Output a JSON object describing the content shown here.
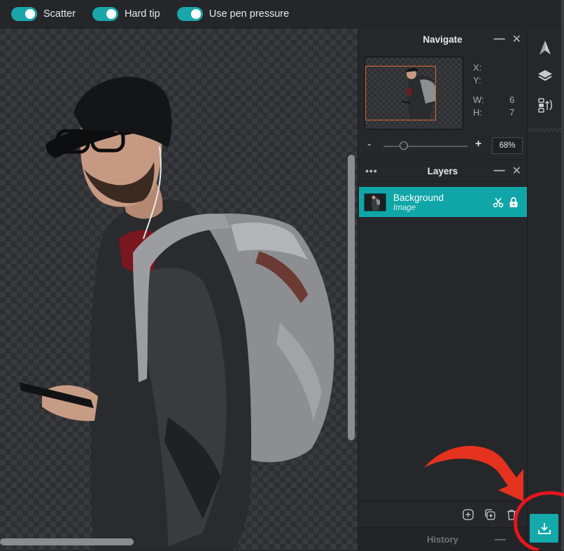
{
  "toolbar": {
    "toggles": [
      {
        "label": "Scatter",
        "on": true
      },
      {
        "label": "Hard tip",
        "on": true
      },
      {
        "label": "Use pen pressure",
        "on": true
      }
    ],
    "accent": "#1aa6a8"
  },
  "navigate": {
    "title": "Navigate",
    "minimize": "—",
    "close": "✕",
    "x_label": "X:",
    "y_label": "Y:",
    "w_label": "W:",
    "w_value": "6",
    "h_label": "H:",
    "h_value": "7",
    "zoom_minus": "-",
    "zoom_plus": "+",
    "zoom_value": "68%",
    "zoom_level": 0.68
  },
  "layers": {
    "title": "Layers",
    "menu": "•••",
    "minimize": "—",
    "close": "✕",
    "items": [
      {
        "name": "Background",
        "type": "Image",
        "selected": true
      }
    ],
    "selected_color": "#10a6a7"
  },
  "history": {
    "title": "History",
    "minimize": "—"
  },
  "strip": {
    "icons": [
      "navigate-arrow-icon",
      "layers-icon",
      "adjust-layers-icon"
    ]
  },
  "download": {
    "icon": "download-icon",
    "color": "#14a9aa"
  }
}
